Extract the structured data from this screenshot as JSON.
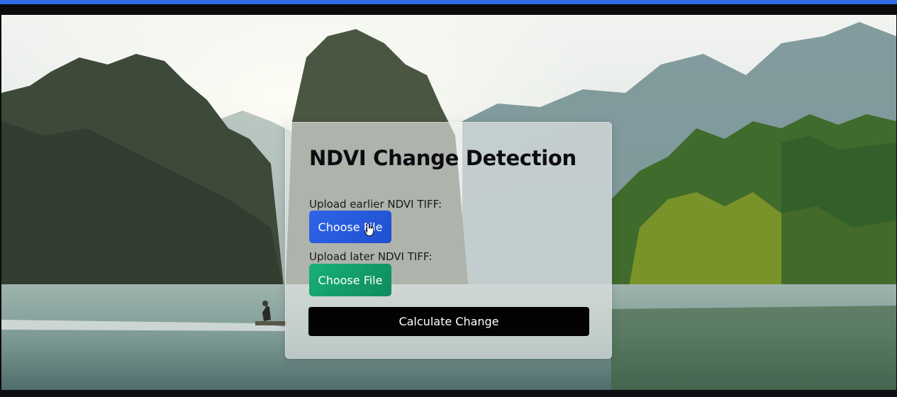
{
  "app": {
    "accent_color": "#2f6be6"
  },
  "background": {
    "description_icon": "landscape-image"
  },
  "card": {
    "title": "NDVI Change Detection",
    "earlier": {
      "label": "Upload earlier NDVI TIFF:",
      "button_label": "Choose File",
      "button_color": "#2f65e8"
    },
    "later": {
      "label": "Upload later NDVI TIFF:",
      "button_label": "Choose File",
      "button_color": "#18b07a"
    },
    "calculate_label": "Calculate Change",
    "calculate_color": "#030303"
  },
  "cursor": {
    "icon": "hand-pointer-icon"
  }
}
